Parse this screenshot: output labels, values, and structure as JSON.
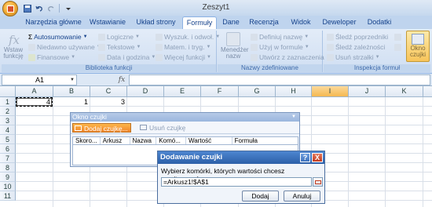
{
  "window": {
    "title": "Zeszyt1"
  },
  "quick_access": {
    "icons": [
      "save-icon",
      "undo-icon",
      "redo-icon",
      "customize-icon"
    ]
  },
  "tabs": [
    {
      "label": "Narzędzia główne",
      "active": false
    },
    {
      "label": "Wstawianie",
      "active": false
    },
    {
      "label": "Układ strony",
      "active": false
    },
    {
      "label": "Formuły",
      "active": true
    },
    {
      "label": "Dane",
      "active": false
    },
    {
      "label": "Recenzja",
      "active": false
    },
    {
      "label": "Widok",
      "active": false
    },
    {
      "label": "Deweloper",
      "active": false
    },
    {
      "label": "Dodatki",
      "active": false
    }
  ],
  "ribbon": {
    "function_library": {
      "label": "Biblioteka funkcji",
      "insert_function": "Wstaw funkcję",
      "autosum": "Autosumowanie",
      "recent": "Niedawno używane",
      "financial": "Finansowe",
      "logical": "Logiczne",
      "text": "Tekstowe",
      "date_time": "Data i godzina",
      "lookup": "Wyszuk. i odwoł.",
      "math": "Matem. i tryg.",
      "more": "Więcej funkcji"
    },
    "defined_names": {
      "label": "Nazwy zdefiniowane",
      "name_manager": "Menedżer nazw",
      "define_name": "Definiuj nazwę",
      "use_in_formula": "Użyj w formule",
      "create_from_selection": "Utwórz z zaznaczenia"
    },
    "formula_auditing": {
      "label": "Inspekcja formuł",
      "trace_precedents": "Śledź poprzedniki",
      "trace_dependents": "Śledź zależności",
      "remove_arrows": "Usuń strzałki",
      "watch_window": "Okno czujki"
    }
  },
  "formula_bar": {
    "name_box": "A1",
    "fx_label": "fx",
    "formula": ""
  },
  "grid": {
    "columns": [
      "A",
      "B",
      "C",
      "D",
      "E",
      "F",
      "G",
      "H",
      "I",
      "J",
      "K"
    ],
    "selected_column": "I",
    "rows": [
      "1",
      "2",
      "3",
      "4",
      "5",
      "6",
      "7",
      "8",
      "9",
      "10",
      "11"
    ],
    "cells": {
      "A1": "4",
      "B1": "1",
      "C1": "3"
    }
  },
  "watch_window": {
    "title": "Okno czujki",
    "add_button": "Dodaj czujkę...",
    "delete_button": "Usuń czujkę",
    "columns": [
      "Skoro...",
      "Arkusz",
      "Nazwa",
      "Komó...",
      "Wartość",
      "Formuła"
    ]
  },
  "add_watch_dialog": {
    "title": "Dodawanie czujki",
    "help": "?",
    "close": "X",
    "prompt": "Wybierz komórki, których wartości chcesz monitorować:",
    "value": "=Arkusz1!$A$1",
    "ok_button": "Dodaj",
    "cancel_button": "Anuluj"
  },
  "colors": {
    "ribbon": "#cfdef2",
    "accent": "#f8c55b",
    "title_bar": "#2c5fa8"
  }
}
